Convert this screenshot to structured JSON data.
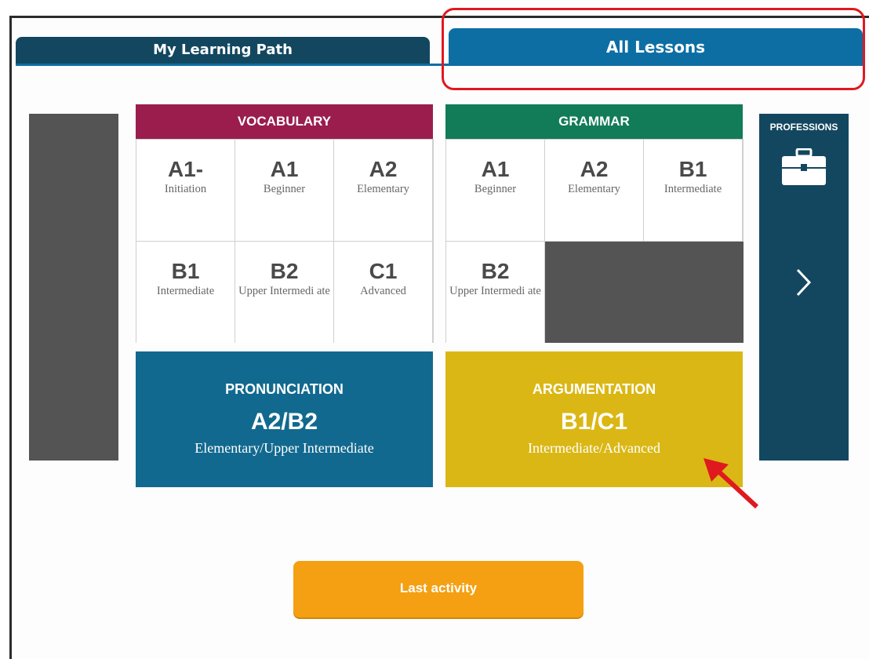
{
  "tabs": {
    "my_learning_path": "My Learning Path",
    "all_lessons": "All Lessons"
  },
  "side_right": {
    "title": "PROFESSIONS",
    "icon": "briefcase-icon",
    "next_icon": "chevron-right-icon"
  },
  "vocabulary": {
    "title": "VOCABULARY",
    "color": "#9a1d4e",
    "levels": [
      {
        "code": "A1-",
        "name": "Initiation"
      },
      {
        "code": "A1",
        "name": "Beginner"
      },
      {
        "code": "A2",
        "name": "Elementary"
      },
      {
        "code": "B1",
        "name": "Intermediate"
      },
      {
        "code": "B2",
        "name": "Upper Intermedi ate"
      },
      {
        "code": "C1",
        "name": "Advanced"
      }
    ]
  },
  "grammar": {
    "title": "GRAMMAR",
    "color": "#127b58",
    "levels": [
      {
        "code": "A1",
        "name": "Beginner"
      },
      {
        "code": "A2",
        "name": "Elementary"
      },
      {
        "code": "B1",
        "name": "Intermediate"
      },
      {
        "code": "B2",
        "name": "Upper Intermedi ate"
      }
    ]
  },
  "pronunciation": {
    "title": "PRONUNCIATION",
    "code": "A2/B2",
    "name": "Elementary/Upper Intermediate",
    "color": "#12698f"
  },
  "argumentation": {
    "title": "ARGUMENTATION",
    "code": "B1/C1",
    "name": "Intermediate/Advanced",
    "color": "#dab715"
  },
  "last_activity": "Last activity",
  "annotation_color": "#e0191f"
}
